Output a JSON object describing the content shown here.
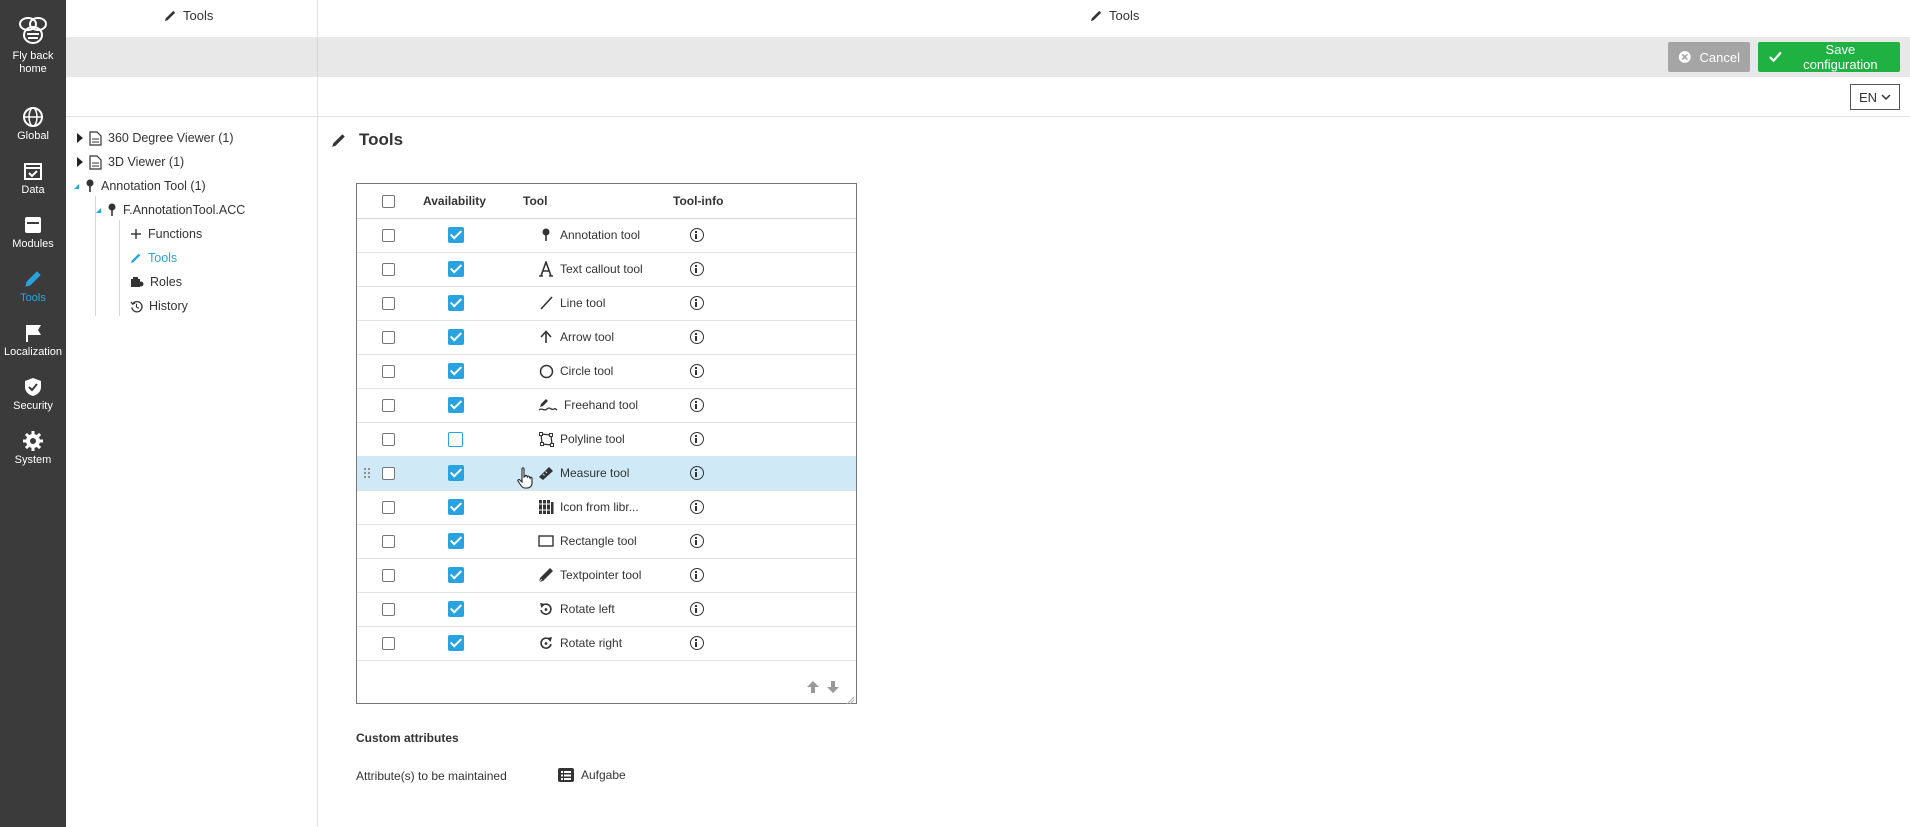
{
  "nav": {
    "items": [
      {
        "label_lines": [
          "Fly back",
          "home"
        ],
        "icon": "bee-logo-icon"
      },
      {
        "label": "Global",
        "icon": "globe-icon"
      },
      {
        "label": "Data",
        "icon": "calendar-icon"
      },
      {
        "label": "Modules",
        "icon": "modules-icon"
      },
      {
        "label": "Tools",
        "icon": "pencil-icon",
        "active": true
      },
      {
        "label": "Localization",
        "icon": "flag-icon"
      },
      {
        "label": "Security",
        "icon": "shield-icon"
      },
      {
        "label": "System",
        "icon": "gear-icon"
      }
    ]
  },
  "header": {
    "left_title": "Tools",
    "main_title": "Tools",
    "cancel_label": "Cancel",
    "save_label": "Save configuration",
    "language": "EN"
  },
  "tree": [
    {
      "label": "360 Degree Viewer (1)",
      "expanded": false
    },
    {
      "label": "3D Viewer (1)",
      "expanded": false
    },
    {
      "label": "Annotation Tool (1)",
      "expanded": true
    },
    {
      "label": "F.AnnotationTool.ACC",
      "expanded": true
    },
    {
      "label": "Functions"
    },
    {
      "label": "Tools",
      "active": true
    },
    {
      "label": "Roles"
    },
    {
      "label": "History"
    }
  ],
  "section": {
    "title": "Tools"
  },
  "table": {
    "columns": {
      "availability": "Availability",
      "tool": "Tool",
      "tool_info": "Tool-info"
    },
    "rows": [
      {
        "tool": "Annotation tool",
        "icon": "pin-icon",
        "available": true
      },
      {
        "tool": "Text callout tool",
        "icon": "text-a-icon",
        "available": true
      },
      {
        "tool": "Line tool",
        "icon": "line-icon",
        "available": true
      },
      {
        "tool": "Arrow tool",
        "icon": "arrow-up-icon",
        "available": true
      },
      {
        "tool": "Circle tool",
        "icon": "circle-icon",
        "available": true
      },
      {
        "tool": "Freehand tool",
        "icon": "freehand-icon",
        "available": true
      },
      {
        "tool": "Polyline tool",
        "icon": "polyline-icon",
        "available": false
      },
      {
        "tool": "Measure tool",
        "icon": "ruler-icon",
        "available": true,
        "highlighted": true
      },
      {
        "tool": "Icon from libr...",
        "icon": "library-icon",
        "available": true
      },
      {
        "tool": "Rectangle tool",
        "icon": "rectangle-icon",
        "available": true
      },
      {
        "tool": "Textpointer tool",
        "icon": "textpointer-icon",
        "available": true
      },
      {
        "tool": "Rotate left",
        "icon": "rotate-left-icon",
        "available": true
      },
      {
        "tool": "Rotate right",
        "icon": "rotate-right-icon",
        "available": true
      }
    ]
  },
  "custom_attributes": {
    "title": "Custom attributes",
    "label": "Attribute(s) to be maintained",
    "value": "Aufgabe"
  },
  "colors": {
    "accent": "#29a3e0",
    "save": "#1fb141",
    "cancel": "#a5a5a5",
    "nav_bg": "#3b3b3b",
    "highlight_row": "#cfe9f7"
  }
}
